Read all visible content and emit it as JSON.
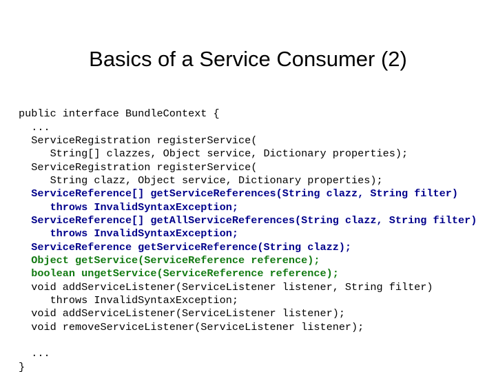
{
  "slide": {
    "title": "Basics of a Service Consumer (2)",
    "background_color": "#ffffff"
  },
  "colors": {
    "text_black": "#000000",
    "keyword_navy": "#00008b",
    "keyword_green": "#127a12"
  },
  "code": {
    "language": "java",
    "lines": [
      {
        "text": "public interface BundleContext {",
        "color": "black"
      },
      {
        "text": "  ...",
        "color": "black"
      },
      {
        "text": "  ServiceRegistration registerService(",
        "color": "black"
      },
      {
        "text": "     String[] clazzes, Object service, Dictionary properties);",
        "color": "black"
      },
      {
        "text": "  ServiceRegistration registerService(",
        "color": "black"
      },
      {
        "text": "     String clazz, Object service, Dictionary properties);",
        "color": "black"
      },
      {
        "text": "  ServiceReference[] getServiceReferences(String clazz, String filter)",
        "color": "navy"
      },
      {
        "text": "     throws InvalidSyntaxException;",
        "color": "navy"
      },
      {
        "text": "  ServiceReference[] getAllServiceReferences(String clazz, String filter)",
        "color": "navy"
      },
      {
        "text": "     throws InvalidSyntaxException;",
        "color": "navy"
      },
      {
        "text": "  ServiceReference getServiceReference(String clazz);",
        "color": "navy"
      },
      {
        "text": "  Object getService(ServiceReference reference);",
        "color": "green"
      },
      {
        "text": "  boolean ungetService(ServiceReference reference);",
        "color": "green"
      },
      {
        "text": "  void addServiceListener(ServiceListener listener, String filter)",
        "color": "black"
      },
      {
        "text": "     throws InvalidSyntaxException;",
        "color": "black"
      },
      {
        "text": "  void addServiceListener(ServiceListener listener);",
        "color": "black"
      },
      {
        "text": "  void removeServiceListener(ServiceListener listener);",
        "color": "black"
      },
      {
        "text": "",
        "color": "black"
      },
      {
        "text": "  ...",
        "color": "black"
      },
      {
        "text": "}",
        "color": "black"
      }
    ]
  }
}
